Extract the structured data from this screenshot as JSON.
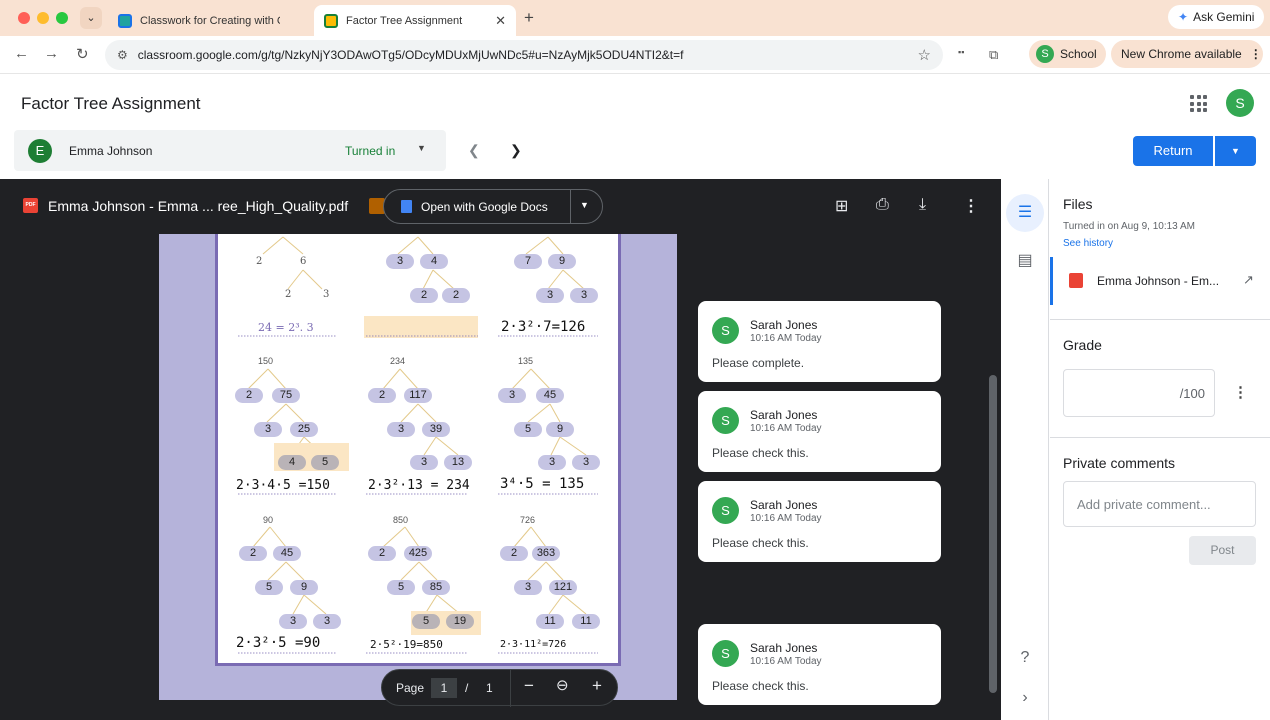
{
  "browser": {
    "tabs": [
      {
        "label": "Classwork for Creating with C"
      },
      {
        "label": "Factor Tree Assignment"
      }
    ],
    "ask_gemini": "Ask Gemini",
    "url": "classroom.google.com/g/tg/NzkyNjY3ODAwOTg5/ODcyMDUxMjUwNDc5#u=NzAyMjk5ODU4NTI2&t=f",
    "profile_label": "School",
    "profile_initial": "S",
    "chrome_update": "New Chrome available"
  },
  "header": {
    "title": "Factor Tree Assignment",
    "user_initial": "S"
  },
  "student": {
    "initial": "E",
    "name": "Emma Johnson",
    "status": "Turned in"
  },
  "actions": {
    "return_label": "Return"
  },
  "viewer": {
    "file_title": "Emma Johnson - Emma ... ree_High_Quality.pdf",
    "pdf_badge": "PDF",
    "open_with": "Open with Google Docs",
    "pager": {
      "label": "Page",
      "current": "1",
      "separator": "/",
      "total": "1"
    }
  },
  "worksheet": {
    "row1": {
      "cells": [
        {
          "leaves": [
            "2",
            "6",
            "2",
            "3"
          ],
          "answer": "24 = 2³. 3"
        },
        {
          "leaves": [
            "3",
            "4",
            "2",
            "2"
          ],
          "answer": ""
        },
        {
          "leaves": [
            "7",
            "9",
            "3",
            "3"
          ],
          "answer": "2·3²·7=126"
        }
      ]
    },
    "row2": {
      "cells": [
        {
          "root": "150",
          "nodes": [
            "2",
            "75",
            "3",
            "25",
            "4",
            "5"
          ],
          "answer": "2·3·4·5 =150"
        },
        {
          "root": "234",
          "nodes": [
            "2",
            "117",
            "3",
            "39",
            "3",
            "13"
          ],
          "answer": "2·3²·13 = 234"
        },
        {
          "root": "135",
          "nodes": [
            "3",
            "45",
            "5",
            "9",
            "3",
            "3"
          ],
          "answer": "3⁴·5 = 135"
        }
      ]
    },
    "row3": {
      "cells": [
        {
          "root": "90",
          "nodes": [
            "2",
            "45",
            "5",
            "9",
            "3",
            "3"
          ],
          "answer": "2·3²·5 =90"
        },
        {
          "root": "850",
          "nodes": [
            "2",
            "425",
            "5",
            "85",
            "5",
            "19"
          ],
          "answer": "2·5²·19=850"
        },
        {
          "root": "726",
          "nodes": [
            "2",
            "363",
            "3",
            "121",
            "11",
            "11"
          ],
          "answer": "2·3·11²=726"
        }
      ]
    }
  },
  "comments": [
    {
      "initial": "S",
      "author": "Sarah Jones",
      "time": "10:16 AM Today",
      "text": "Please complete."
    },
    {
      "initial": "S",
      "author": "Sarah Jones",
      "time": "10:16 AM Today",
      "text": "Please check this."
    },
    {
      "initial": "S",
      "author": "Sarah Jones",
      "time": "10:16 AM Today",
      "text": "Please check this."
    },
    {
      "initial": "S",
      "author": "Sarah Jones",
      "time": "10:16 AM Today",
      "text": "Please check this."
    }
  ],
  "panel": {
    "files_heading": "Files",
    "turned_in": "Turned in on Aug 9, 10:13 AM",
    "see_history": "See history",
    "attachment": "Emma Johnson - Em...",
    "grade_heading": "Grade",
    "grade_denominator": "/100",
    "private_heading": "Private comments",
    "comment_placeholder": "Add private comment...",
    "post_label": "Post"
  }
}
